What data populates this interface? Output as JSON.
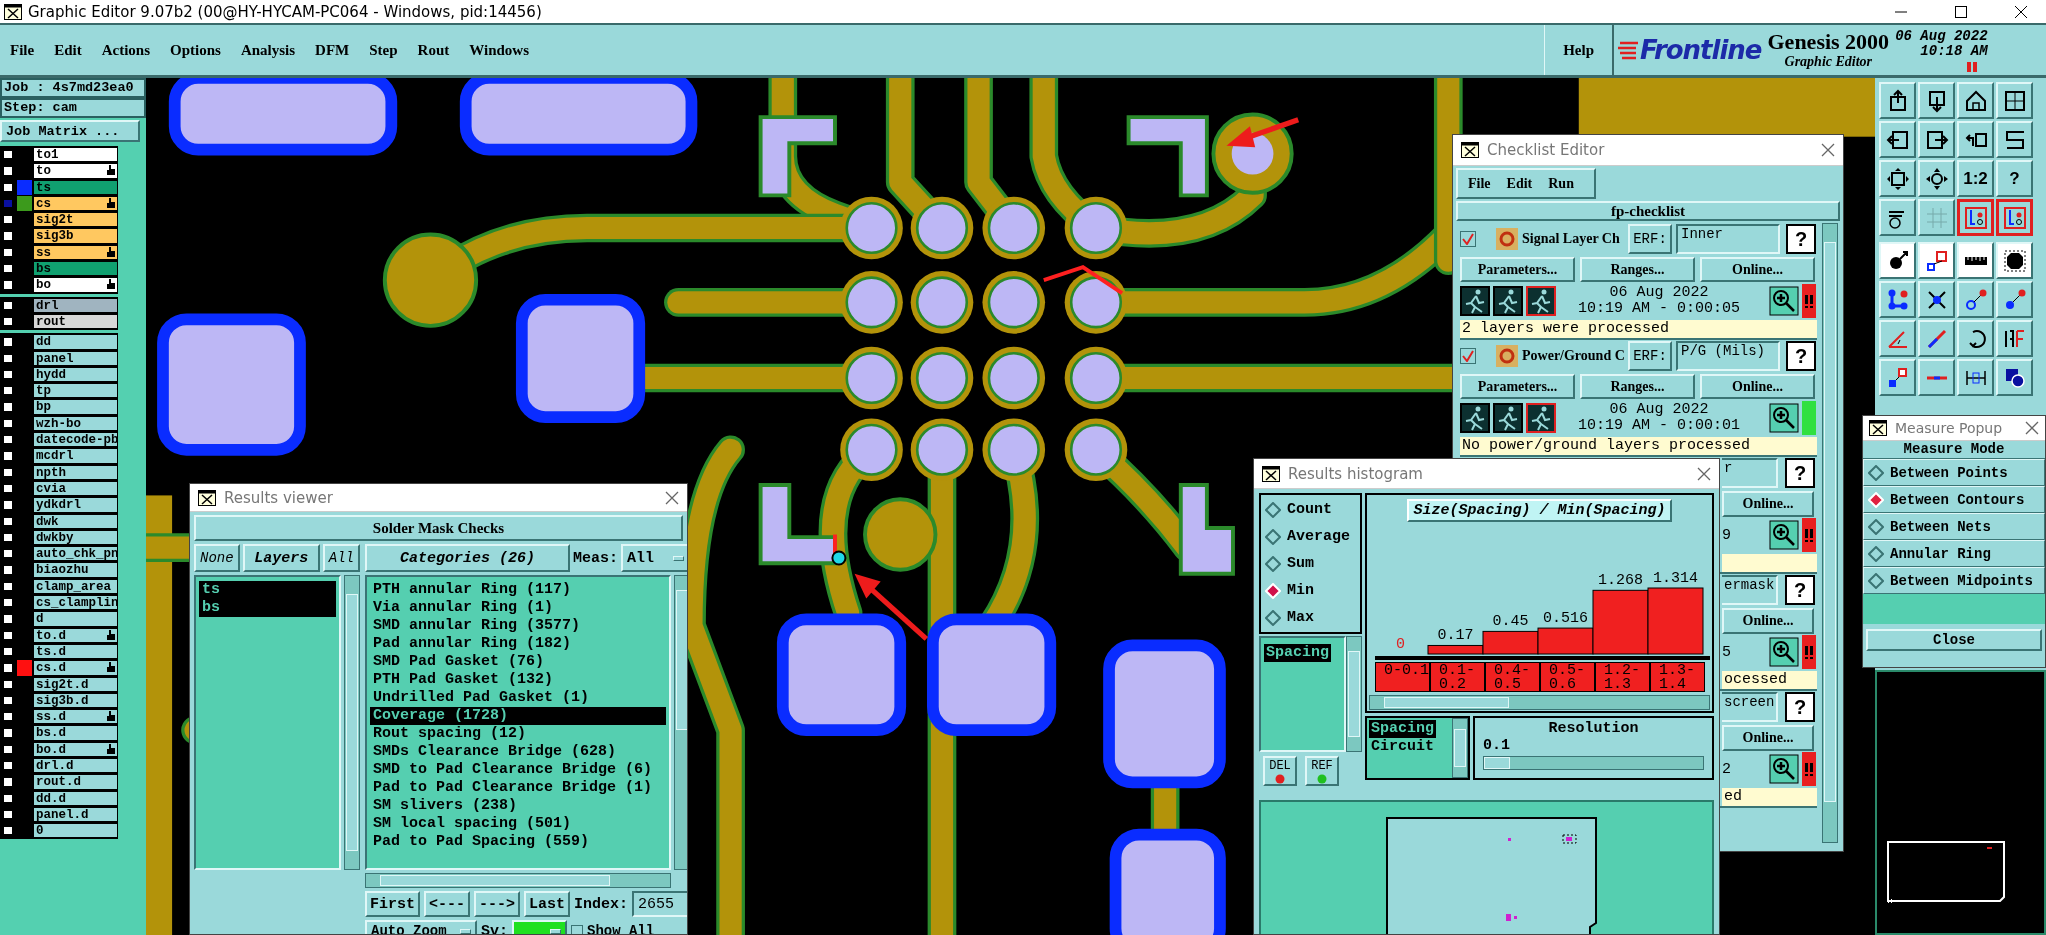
{
  "window": {
    "title": "Graphic Editor 9.07b2 (00@HY-HYCAM-PC064 - Windows, pid:14456)"
  },
  "menu": [
    "File",
    "Edit",
    "Actions",
    "Options",
    "Analysis",
    "DFM",
    "Step",
    "Rout",
    "Windows"
  ],
  "help": "Help",
  "logo": {
    "brand": "Frontline",
    "product": "Genesis 2000",
    "subtitle": "Graphic Editor",
    "date": "06 Aug 2022",
    "time": "10:18 AM"
  },
  "job": {
    "job": "Job : 4s7md23ea0",
    "step": "Step: cam",
    "matrix_button": "Job Matrix ..."
  },
  "layer_groups": [
    {
      "layers": [
        {
          "name": "to1",
          "kind": "outer",
          "selected": false,
          "affected": false
        },
        {
          "name": "to",
          "kind": "outer",
          "selected": false,
          "affected": true
        },
        {
          "name": "ts",
          "kind": "mask",
          "selected": false,
          "affected": false,
          "color": "#0a2cff"
        },
        {
          "name": "cs",
          "kind": "signal",
          "selected": true,
          "affected": true,
          "color": "#3c9a1c"
        },
        {
          "name": "sig2t",
          "kind": "signal",
          "selected": false,
          "affected": false
        },
        {
          "name": "sig3b",
          "kind": "signal",
          "selected": false,
          "affected": false
        },
        {
          "name": "ss",
          "kind": "signal",
          "selected": false,
          "affected": true
        },
        {
          "name": "bs",
          "kind": "mask",
          "selected": false,
          "affected": false
        },
        {
          "name": "bo",
          "kind": "outer",
          "selected": false,
          "affected": true
        }
      ]
    },
    {
      "layers": [
        {
          "name": "drl",
          "kind": "drill",
          "selected": false,
          "affected": false
        },
        {
          "name": "rout",
          "kind": "rout",
          "selected": false,
          "affected": false
        }
      ]
    },
    {
      "layers": [
        {
          "name": "dd",
          "kind": "misc",
          "selected": false,
          "affected": false
        },
        {
          "name": "panel",
          "kind": "misc",
          "selected": false,
          "affected": false
        },
        {
          "name": "hydd",
          "kind": "misc",
          "selected": false,
          "affected": false
        },
        {
          "name": "tp",
          "kind": "misc",
          "selected": false,
          "affected": false
        },
        {
          "name": "bp",
          "kind": "misc",
          "selected": false,
          "affected": false
        },
        {
          "name": "wzh-bo",
          "kind": "misc",
          "selected": false,
          "affected": false
        },
        {
          "name": "datecode-pb",
          "kind": "misc",
          "selected": false,
          "affected": false
        },
        {
          "name": "mcdrl",
          "kind": "misc",
          "selected": false,
          "affected": false
        },
        {
          "name": "npth",
          "kind": "misc",
          "selected": false,
          "affected": false
        },
        {
          "name": "cvia",
          "kind": "misc",
          "selected": false,
          "affected": false
        },
        {
          "name": "ydkdrl",
          "kind": "misc",
          "selected": false,
          "affected": false
        },
        {
          "name": "dwk",
          "kind": "misc",
          "selected": false,
          "affected": false
        },
        {
          "name": "dwkby",
          "kind": "misc",
          "selected": false,
          "affected": false
        },
        {
          "name": "auto_chk_pn",
          "kind": "misc",
          "selected": false,
          "affected": false
        },
        {
          "name": "biaozhu",
          "kind": "misc",
          "selected": false,
          "affected": false
        },
        {
          "name": "clamp_area",
          "kind": "misc",
          "selected": false,
          "affected": false
        },
        {
          "name": "cs_clamplin",
          "kind": "misc",
          "selected": false,
          "affected": false
        },
        {
          "name": "d",
          "kind": "misc",
          "selected": false,
          "affected": false
        },
        {
          "name": "to.d",
          "kind": "misc",
          "selected": false,
          "affected": true
        },
        {
          "name": "ts.d",
          "kind": "misc",
          "selected": false,
          "affected": false
        },
        {
          "name": "cs.d",
          "kind": "misc",
          "selected": false,
          "affected": true,
          "color": "#ff1010"
        },
        {
          "name": "sig2t.d",
          "kind": "misc",
          "selected": false,
          "affected": false
        },
        {
          "name": "sig3b.d",
          "kind": "misc",
          "selected": false,
          "affected": false
        },
        {
          "name": "ss.d",
          "kind": "misc",
          "selected": false,
          "affected": true
        },
        {
          "name": "bs.d",
          "kind": "misc",
          "selected": false,
          "affected": false
        },
        {
          "name": "bo.d",
          "kind": "misc",
          "selected": false,
          "affected": true
        },
        {
          "name": "drl.d",
          "kind": "misc",
          "selected": false,
          "affected": false
        },
        {
          "name": "rout.d",
          "kind": "misc",
          "selected": false,
          "affected": false
        },
        {
          "name": "dd.d",
          "kind": "misc",
          "selected": false,
          "affected": false
        },
        {
          "name": "panel.d",
          "kind": "misc",
          "selected": false,
          "affected": false
        },
        {
          "name": "0",
          "kind": "misc",
          "selected": false,
          "affected": false
        }
      ]
    }
  ],
  "toolbar": [
    {
      "kind": "upload",
      "on": false
    },
    {
      "kind": "download",
      "on": false
    },
    {
      "kind": "house",
      "on": false
    },
    {
      "kind": "grid-corner",
      "on": false
    },
    {
      "kind": "arrow-left-box",
      "on": false
    },
    {
      "kind": "arrow-right-box",
      "on": false
    },
    {
      "kind": "undo-box",
      "on": false
    },
    {
      "kind": "zigzag",
      "on": false
    },
    {
      "kind": "expand",
      "on": false
    },
    {
      "kind": "compass",
      "on": false
    },
    {
      "kind": "text",
      "label": "1:2",
      "on": false
    },
    {
      "kind": "text",
      "label": "?",
      "on": false
    },
    {
      "kind": "palette",
      "on": false
    },
    {
      "kind": "grid",
      "on": false
    },
    {
      "kind": "layer-stack",
      "on": true
    },
    {
      "kind": "layer-stack",
      "on": true
    },
    {
      "kind": "pad-arrow",
      "on": false
    },
    {
      "kind": "polygon",
      "on": false
    },
    {
      "kind": "ruler",
      "on": false
    },
    {
      "kind": "octagon",
      "on": false
    },
    {
      "kind": "nodes",
      "on": false
    },
    {
      "kind": "cross-node",
      "on": false
    },
    {
      "kind": "circle-arrow",
      "on": false
    },
    {
      "kind": "dot-arrow",
      "on": false
    },
    {
      "kind": "angle",
      "on": false
    },
    {
      "kind": "diagonal",
      "on": false
    },
    {
      "kind": "rotate",
      "on": false
    },
    {
      "kind": "mirror",
      "on": false
    },
    {
      "kind": "square-select",
      "on": false
    },
    {
      "kind": "bar-line",
      "on": false
    },
    {
      "kind": "width-measure",
      "on": false
    },
    {
      "kind": "shapes",
      "on": false
    }
  ],
  "results_viewer": {
    "title": "Results viewer",
    "header": "Solder Mask Checks",
    "layer_buttons": [
      "None",
      "Layers",
      "All"
    ],
    "layers": [
      {
        "name": "ts",
        "selected": true
      },
      {
        "name": "bs",
        "selected": true
      }
    ],
    "categories_button": "Categories (26)",
    "meas_label": "Meas:",
    "meas_value": "All",
    "categories": [
      {
        "label": "PTH annular Ring (117)",
        "selected": false
      },
      {
        "label": "Via annular Ring (1)",
        "selected": false
      },
      {
        "label": "SMD annular Ring (3577)",
        "selected": false
      },
      {
        "label": "Pad annular Ring (182)",
        "selected": false
      },
      {
        "label": "SMD Pad Gasket (76)",
        "selected": false
      },
      {
        "label": "PTH Pad Gasket (132)",
        "selected": false
      },
      {
        "label": "Undrilled Pad Gasket (1)",
        "selected": false
      },
      {
        "label": "Coverage (1728)",
        "selected": true
      },
      {
        "label": "Rout spacing (12)",
        "selected": false
      },
      {
        "label": "SMDs Clearance Bridge (628)",
        "selected": false
      },
      {
        "label": "SMD to Pad Clearance Bridge (6)",
        "selected": false
      },
      {
        "label": "Pad to Pad Clearance Bridge (1)",
        "selected": false
      },
      {
        "label": "SM slivers (238)",
        "selected": false
      },
      {
        "label": "SM local spacing (501)",
        "selected": false
      },
      {
        "label": "Pad to Pad Spacing (559)",
        "selected": false
      }
    ],
    "nav": [
      "First",
      "<---",
      "--->",
      "Last"
    ],
    "index_label": "Index:",
    "index_value": "2655",
    "zoom_value": "Auto Zoom",
    "sv_label": "Sv:",
    "show_all": {
      "label": "Show All",
      "checked": false
    }
  },
  "checklist_editor": {
    "title": "Checklist Editor",
    "menu": [
      "File",
      "Edit",
      "Run"
    ],
    "name": "fp-checklist",
    "checks": [
      {
        "kind": "full",
        "enabled": true,
        "title": "Signal Layer Ch",
        "erf_label": "ERF:",
        "erf_value": "Inner",
        "help": "?",
        "buttons": [
          "Parameters...",
          "Ranges...",
          "Online..."
        ],
        "date": "06 Aug 2022",
        "time": "10:19 AM - 0:00:05",
        "status": "2 layers were processed",
        "passed": false
      },
      {
        "kind": "full",
        "enabled": true,
        "title": "Power/Ground C",
        "erf_label": "ERF:",
        "erf_value": "P/G (Mils)",
        "help": "?",
        "buttons": [
          "Parameters...",
          "Ranges...",
          "Online..."
        ],
        "date": "06 Aug 2022",
        "time": "10:19 AM - 0:00:01",
        "status": "No power/ground layers processed",
        "passed": true
      },
      {
        "kind": "partial",
        "erf_value": "r",
        "help": "?",
        "buttons": [
          "Online..."
        ],
        "time": "9",
        "passed": false
      },
      {
        "kind": "partial",
        "erf_value": "ermask",
        "help": "?",
        "buttons": [
          "Online..."
        ],
        "time": "5",
        "status": "ocessed",
        "passed": false
      },
      {
        "kind": "partial",
        "erf_value": "screen",
        "help": "?",
        "buttons": [
          "Online..."
        ],
        "time": "2",
        "status": "ed",
        "passed": false
      }
    ]
  },
  "histogram": {
    "title": "Results histogram",
    "modes": [
      {
        "label": "Count",
        "selected": false
      },
      {
        "label": "Average",
        "selected": false
      },
      {
        "label": "Sum",
        "selected": false
      },
      {
        "label": "Min",
        "selected": true
      },
      {
        "label": "Max",
        "selected": false
      }
    ],
    "fields": [
      {
        "label": "Spacing",
        "selected": true
      }
    ],
    "del": "DEL",
    "ref": "REF",
    "chart_data": {
      "type": "bar",
      "title": "Size(Spacing) / Min(Spacing)",
      "categories": [
        "0-0.1",
        "0.1-0.2",
        "0.4-0.5",
        "0.5-0.6",
        "1.2-1.3",
        "1.3-1.4"
      ],
      "values": [
        0,
        0.17,
        0.45,
        0.516,
        1.268,
        1.314
      ],
      "data_labels": true
    },
    "attributes": [
      {
        "label": "Spacing",
        "selected": true
      },
      {
        "label": "Circuit",
        "selected": false
      }
    ],
    "resolution": {
      "label": "Resolution",
      "value": "0.1",
      "level": 0.12
    }
  },
  "measure_popup": {
    "title": "Measure Popup",
    "header": "Measure Mode",
    "modes": [
      {
        "label": "Between Points",
        "selected": false
      },
      {
        "label": "Between Contours",
        "selected": true
      },
      {
        "label": "Between Nets",
        "selected": false
      },
      {
        "label": "Annular Ring",
        "selected": false
      },
      {
        "label": "Between Midpoints",
        "selected": false
      }
    ],
    "close": "Close"
  }
}
